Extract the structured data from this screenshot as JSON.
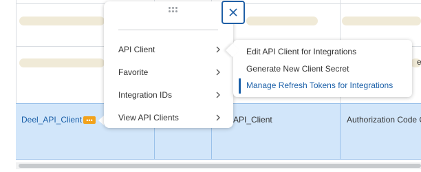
{
  "table": {
    "selected_row": {
      "name_link": "Deel_API_Client",
      "client_name": "API_Client",
      "grant_type": "Authorization Code G"
    },
    "right_edge_fragment": "e"
  },
  "colors": {
    "accent": "#1a5fa8",
    "selected_row_bg": "#d2e6fa",
    "related_actions_button": "#f2a21b",
    "skeleton": "#f0ead7"
  },
  "menu": {
    "drag_icon": "drag-handle-icon",
    "close_icon": "close-icon",
    "items": [
      {
        "label": "API Client",
        "icon": "chevron-right-icon"
      },
      {
        "label": "Favorite",
        "icon": "chevron-right-icon"
      },
      {
        "label": "Integration IDs",
        "icon": "chevron-right-icon"
      },
      {
        "label": "View API Clients",
        "icon": "chevron-right-icon"
      }
    ]
  },
  "submenu": {
    "items": [
      {
        "label": "Edit API Client for Integrations"
      },
      {
        "label": "Generate New Client Secret"
      },
      {
        "label": "Manage Refresh Tokens for Integrations",
        "active": true
      }
    ]
  }
}
